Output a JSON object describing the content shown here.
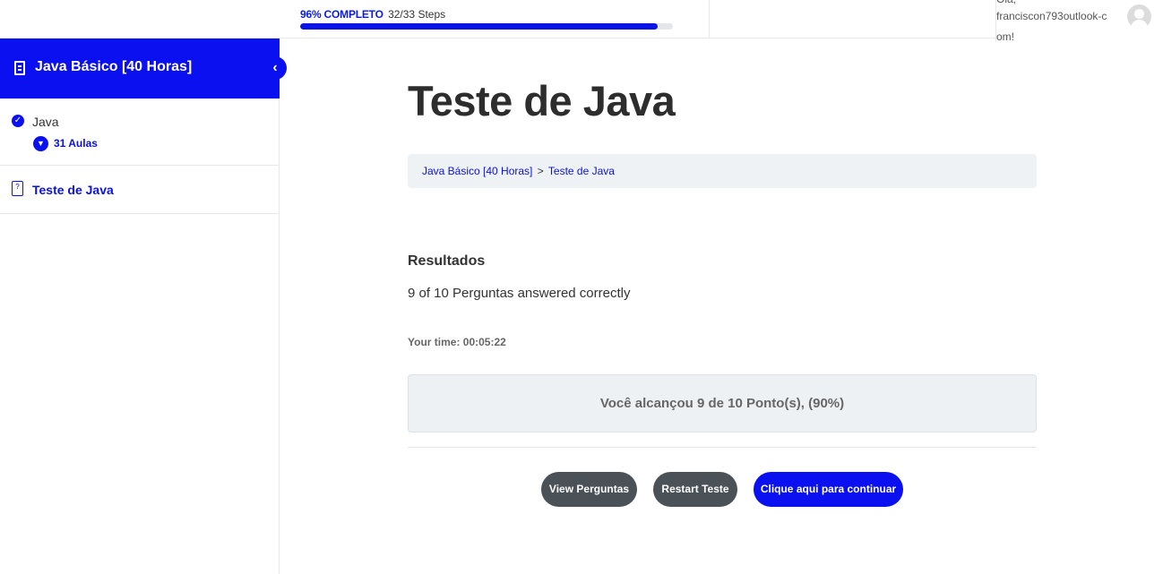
{
  "header": {
    "progress": {
      "percent_label": "96% COMPLETO",
      "steps_label": "32/33 Steps",
      "fraction": 0.96
    },
    "user": {
      "greeting": "Olá,",
      "name": "franciscon793outlook-com!"
    }
  },
  "sidebar": {
    "course_title": "Java Básico [40 Horas]",
    "collapse_icon": "chevron-left-icon",
    "lesson": {
      "title": "Java",
      "count_label": "31 Aulas",
      "completed": true
    },
    "quiz": {
      "label": "Teste de Java"
    }
  },
  "main": {
    "title": "Teste de Java",
    "breadcrumb": {
      "course": "Java Básico [40 Horas]",
      "separator": ">",
      "current": "Teste de Java"
    },
    "results": {
      "heading": "Resultados",
      "summary": "9 of 10 Perguntas answered correctly",
      "time": "Your time: 00:05:22",
      "score": "Você alcançou 9 de 10 Ponto(s), (90%)"
    },
    "buttons": {
      "view": "View Perguntas",
      "restart": "Restart Teste",
      "continue": "Clique aqui para continuar"
    }
  },
  "colors": {
    "accent": "#0a10f0",
    "button_dark": "#4a5258",
    "panel_bg": "#eef1f4"
  }
}
